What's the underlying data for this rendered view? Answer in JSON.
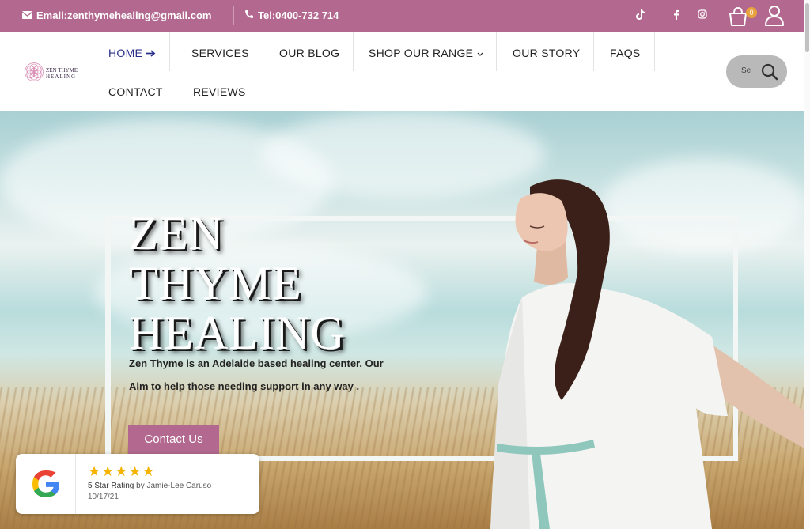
{
  "topbar": {
    "email": "Email:zenthymehealing@gmail.com",
    "tel": "Tel:0400-732 714",
    "social_icons": [
      "tiktok-icon",
      "facebook-icon",
      "instagram-icon"
    ],
    "cart_count": "0",
    "bg_color": "#b3698f"
  },
  "logo": {
    "line1": "ZEN THYME",
    "line2": "HEALING"
  },
  "nav": {
    "items": [
      {
        "label": "HOME",
        "active": true
      },
      {
        "label": "SERVICES"
      },
      {
        "label": "OUR BLOG"
      },
      {
        "label": "SHOP OUR RANGE"
      },
      {
        "label": "OUR STORY"
      },
      {
        "label": "FAQS"
      },
      {
        "label": "CONTACT"
      },
      {
        "label": "REVIEWS"
      }
    ],
    "active_color": "#2a2f8a"
  },
  "search": {
    "placeholder": "Search"
  },
  "hero": {
    "title_line1": "ZEN",
    "title_line2": "THYME",
    "title_line3": "HEALING",
    "desc_line1": "Zen Thyme is an Adelaide based healing center. Our",
    "desc_line2": "Aim to help those needing support in any way .",
    "cta_label": "Contact Us"
  },
  "review": {
    "stars": "★★★★★",
    "rating_text": "5 Star Rating",
    "by_text": "by Jamie-Lee Caruso",
    "date": "10/17/21"
  }
}
